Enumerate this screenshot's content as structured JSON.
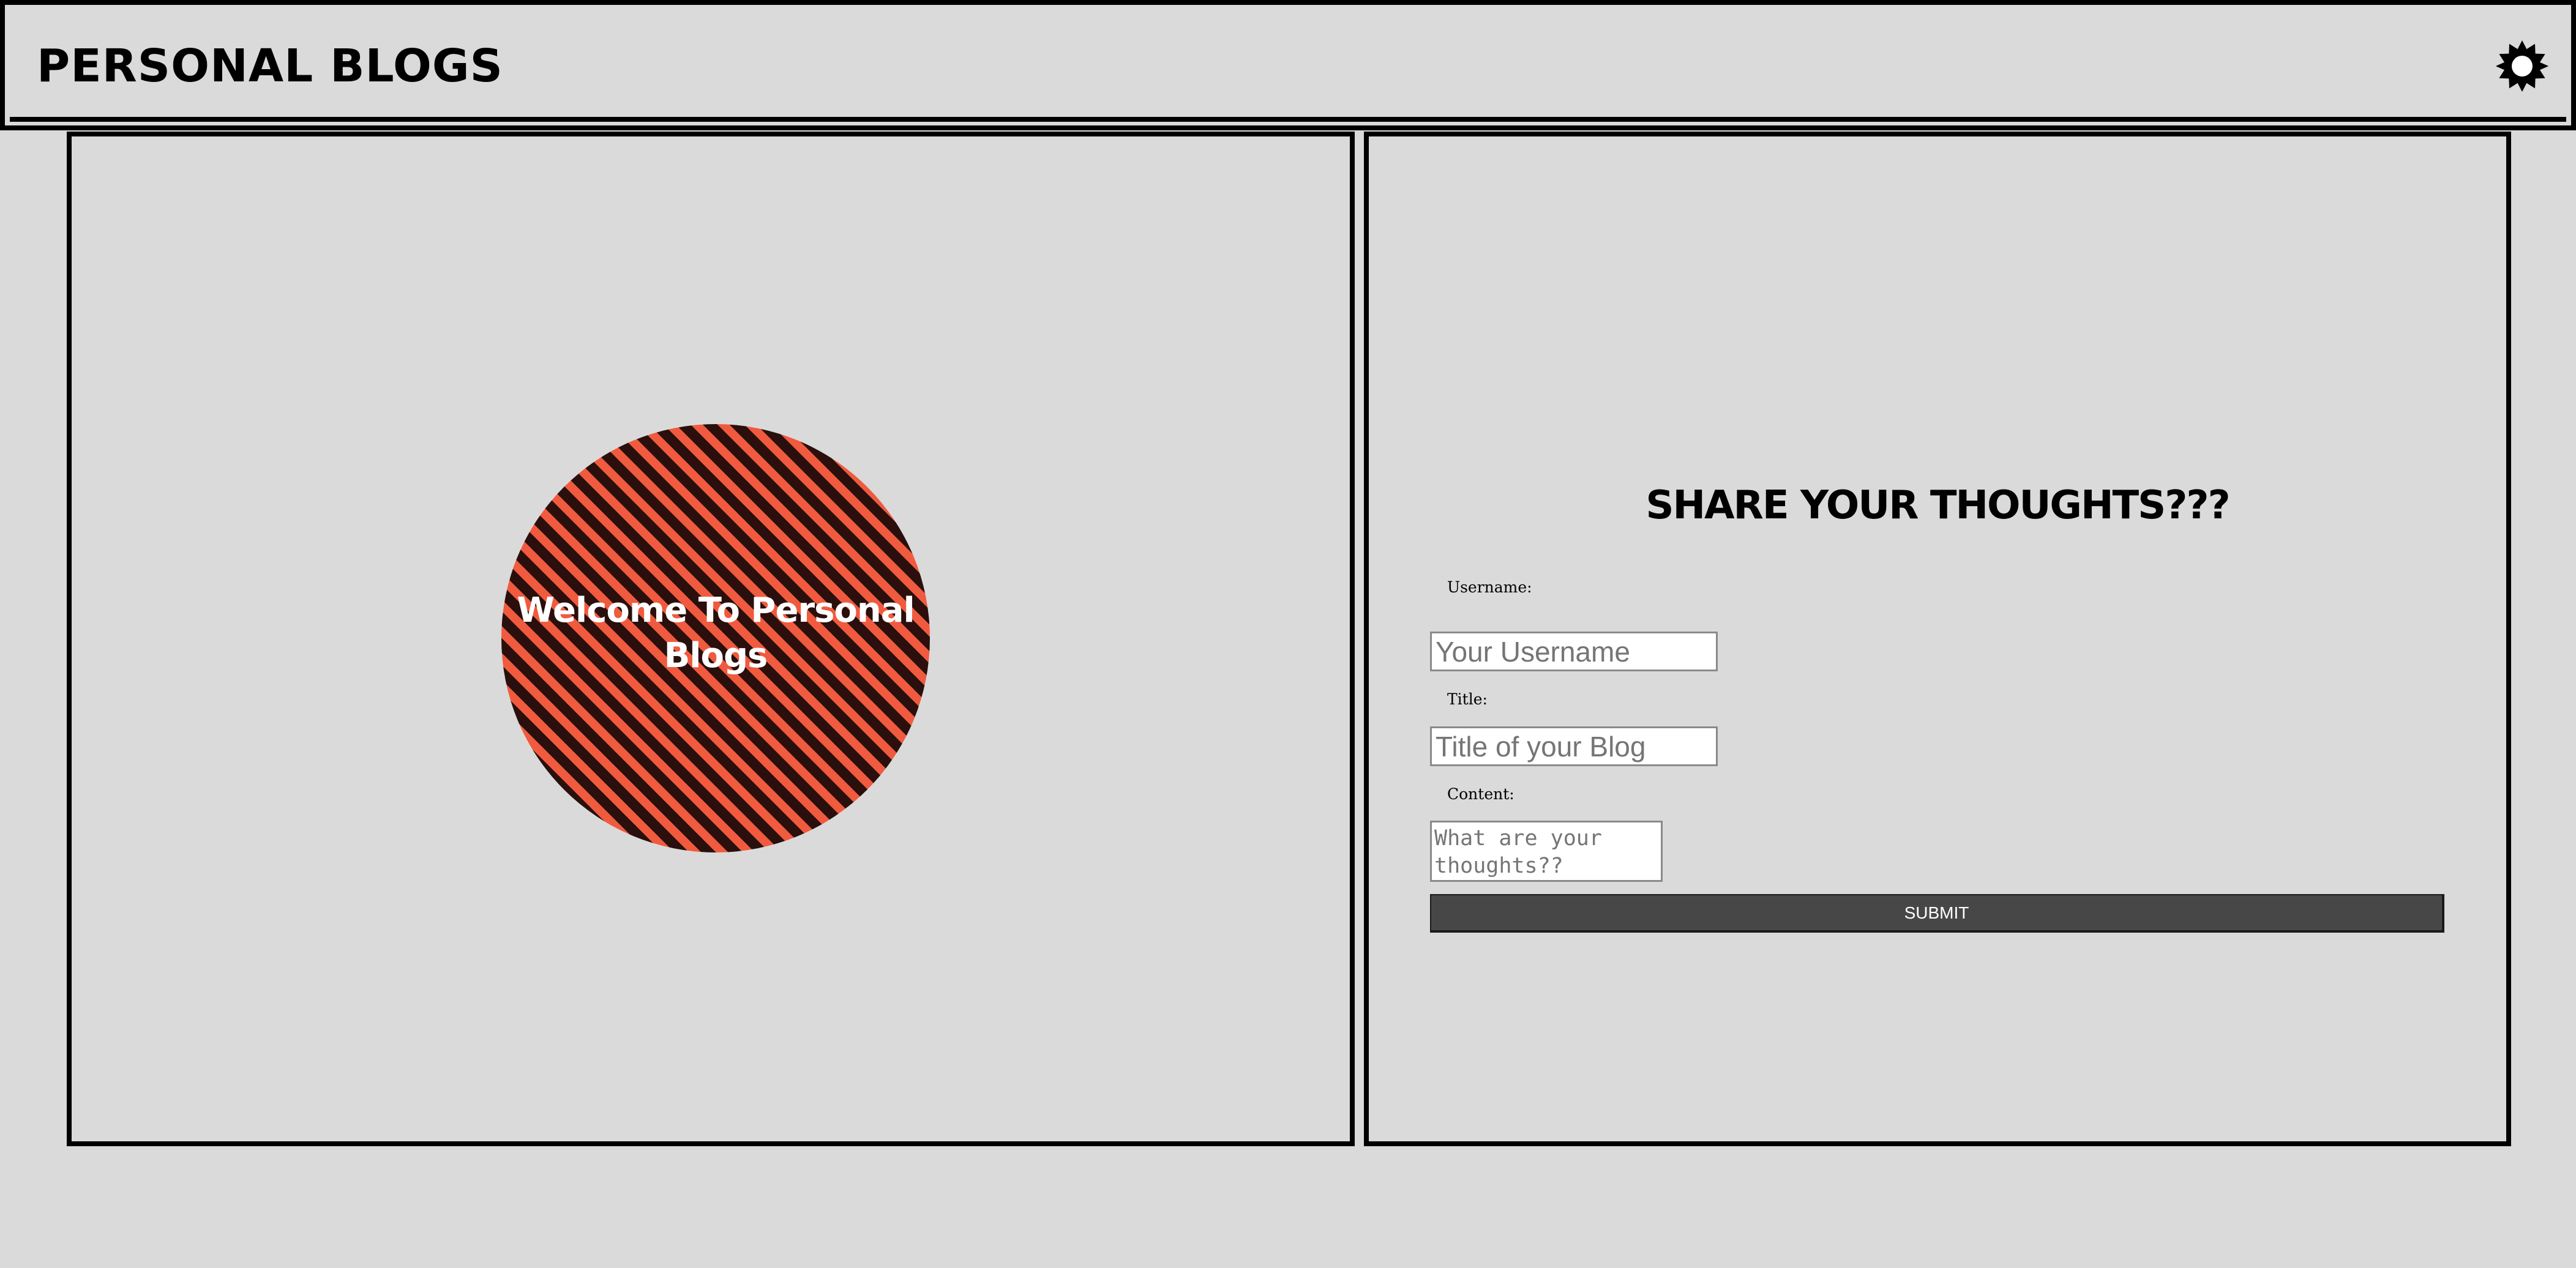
{
  "header": {
    "title": "PERSONAL BLOGS",
    "theme_toggle_icon": "sun-icon"
  },
  "welcome": {
    "text": "Welcome To Personal Blogs",
    "colors": {
      "stripe_light": "#f05a3e",
      "stripe_dark": "#2a0f0c"
    }
  },
  "form": {
    "title": "SHARE YOUR THOUGHTS???",
    "username_label": "Username:",
    "username_placeholder": "Your Username",
    "title_label": "Title:",
    "title_placeholder": "Title of your Blog",
    "content_label": "Content:",
    "content_placeholder": "What are your thoughts??",
    "submit_label": "SUBMIT"
  },
  "colors": {
    "background": "#dadada",
    "border": "#000000",
    "button": "#474747"
  }
}
